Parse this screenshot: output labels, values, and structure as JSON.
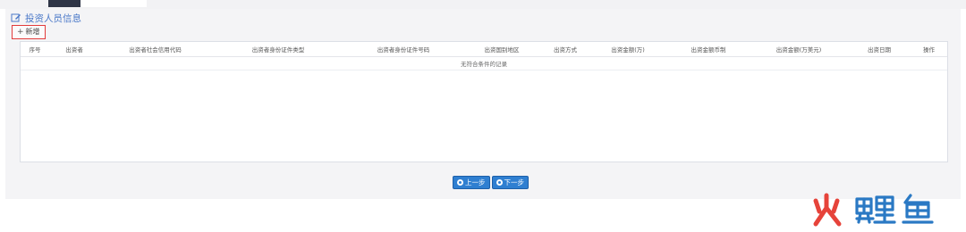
{
  "section": {
    "title": "投资人员信息",
    "icon": "edit-icon"
  },
  "toolbar": {
    "add_label": "新增",
    "add_icon": "plus-icon"
  },
  "table": {
    "columns": [
      "序号",
      "出资者",
      "出资者社会信用代码",
      "出资者身份证件类型",
      "出资者身份证件号码",
      "出资国别地区",
      "出资方式",
      "出资金额(万)",
      "出资金额币制",
      "出资金额(万美元)",
      "出资日期",
      "操作"
    ],
    "empty_message": "无符合条件的记录"
  },
  "nav": {
    "prev_label": "上一步",
    "next_label": "下一步"
  },
  "watermark": {
    "text": "火鲤鱼",
    "colors": {
      "fire": "#e6433a",
      "fish": "#2a79c4"
    }
  }
}
